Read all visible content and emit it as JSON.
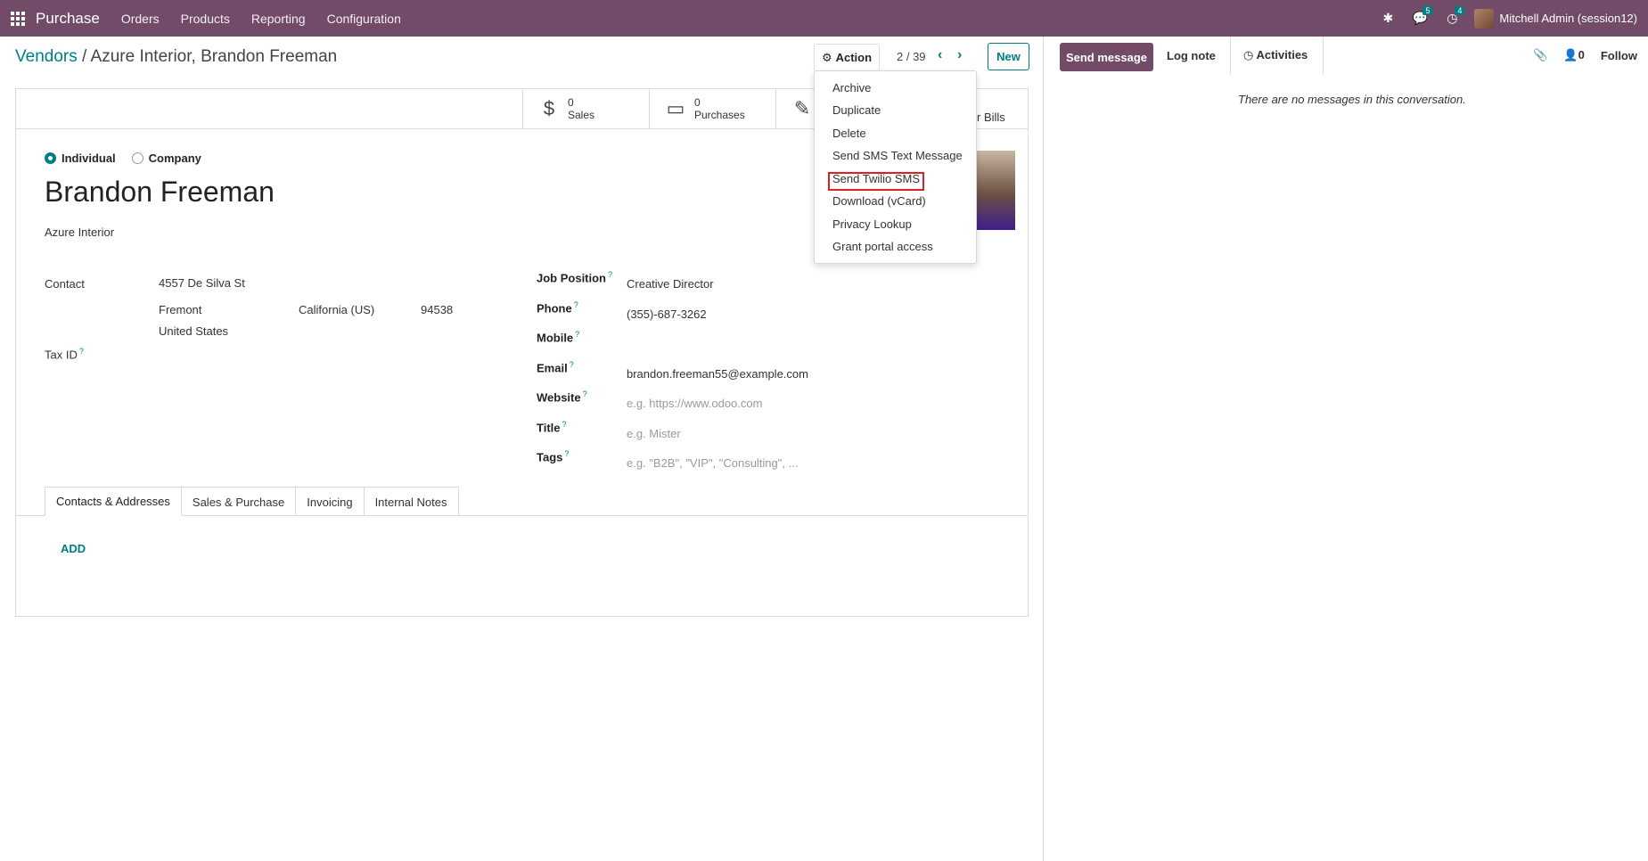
{
  "topnav": {
    "app_name": "Purchase",
    "menu": [
      "Orders",
      "Products",
      "Reporting",
      "Configuration"
    ],
    "messages_count": "5",
    "activities_count": "4",
    "user_name": "Mitchell Admin (session12)"
  },
  "breadcrumb": {
    "parent": "Vendors",
    "separator": "/",
    "current": "Azure Interior, Brandon Freeman"
  },
  "toolbar": {
    "action_label": "Action",
    "pager": "2 / 39",
    "new_label": "New"
  },
  "action_menu": {
    "items": [
      "Archive",
      "Duplicate",
      "Delete",
      "Send SMS Text Message",
      "Send Twilio SMS",
      "Download (vCard)",
      "Privacy Lookup",
      "Grant portal access"
    ],
    "highlighted": "Send Twilio SMS"
  },
  "smart_buttons": {
    "sales_count": "0",
    "sales_label": "Sales",
    "purchases_count": "0",
    "purchases_label": "Purchases",
    "vendor_bills_label": "r Bills"
  },
  "form": {
    "type_individual": "Individual",
    "type_company": "Company",
    "name": "Brandon Freeman",
    "company": "Azure Interior",
    "contact_label": "Contact",
    "street": "4557 De Silva St",
    "city": "Fremont",
    "state": "California (US)",
    "zip": "94538",
    "country": "United States",
    "tax_id_label": "Tax ID",
    "job_position_label": "Job Position",
    "job_position": "Creative Director",
    "phone_label": "Phone",
    "phone": "(355)-687-3262",
    "mobile_label": "Mobile",
    "email_label": "Email",
    "email": "brandon.freeman55@example.com",
    "website_label": "Website",
    "website_placeholder": "e.g. https://www.odoo.com",
    "title_label": "Title",
    "title_placeholder": "e.g. Mister",
    "tags_label": "Tags",
    "tags_placeholder": "e.g. \"B2B\", \"VIP\", \"Consulting\", ...",
    "help_mark": "?"
  },
  "tabs": [
    "Contacts & Addresses",
    "Sales & Purchase",
    "Invoicing",
    "Internal Notes"
  ],
  "contacts_tab": {
    "add_label": "ADD"
  },
  "chatter": {
    "send_message": "Send message",
    "log_note": "Log note",
    "activities": "Activities",
    "followers_count": "0",
    "follow": "Follow",
    "empty": "There are no messages in this conversation."
  },
  "colors": {
    "brand": "#714b67",
    "accent": "#017e84",
    "highlight": "#e02020"
  }
}
